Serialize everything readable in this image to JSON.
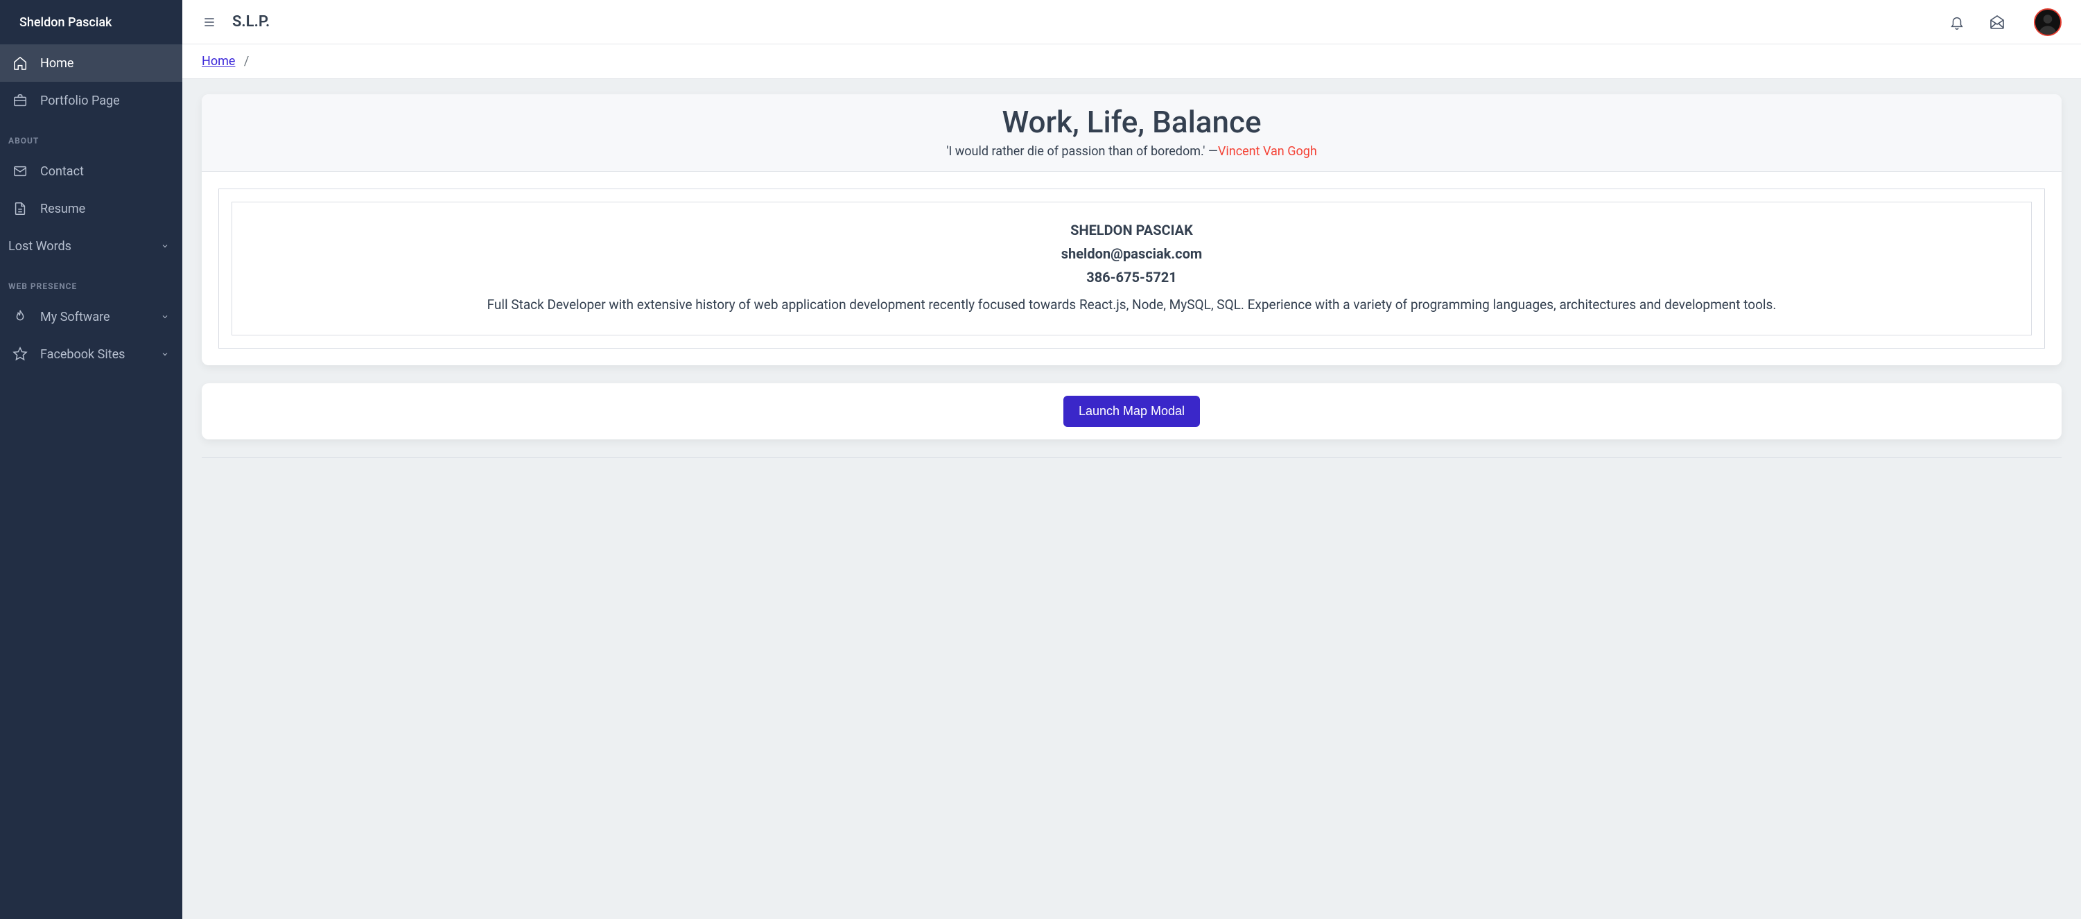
{
  "sidebar": {
    "brand": "Sheldon Pasciak",
    "items": [
      {
        "label": "Home"
      },
      {
        "label": "Portfolio Page"
      }
    ],
    "group_about": "ABOUT",
    "about_items": [
      {
        "label": "Contact"
      },
      {
        "label": "Resume"
      },
      {
        "label": "Lost Words"
      }
    ],
    "group_web": "WEB PRESENCE",
    "web_items": [
      {
        "label": "My Software"
      },
      {
        "label": "Facebook Sites"
      }
    ]
  },
  "topbar": {
    "title": "S.L.P."
  },
  "breadcrumb": {
    "home": "Home",
    "sep": "/"
  },
  "hero": {
    "title": "Work, Life, Balance",
    "quote_text": "'I would rather die of passion than of boredom.' —",
    "quote_author": "Vincent Van Gogh"
  },
  "profile": {
    "name": "SHELDON PASCIAK",
    "email": "sheldon@pasciak.com",
    "phone": "386-675-5721",
    "summary": "Full Stack Developer with extensive history of web application development recently focused towards React.js, Node, MySQL, SQL. Experience with a variety of programming languages, architectures and development tools."
  },
  "actions": {
    "launch_map": "Launch Map Modal"
  }
}
